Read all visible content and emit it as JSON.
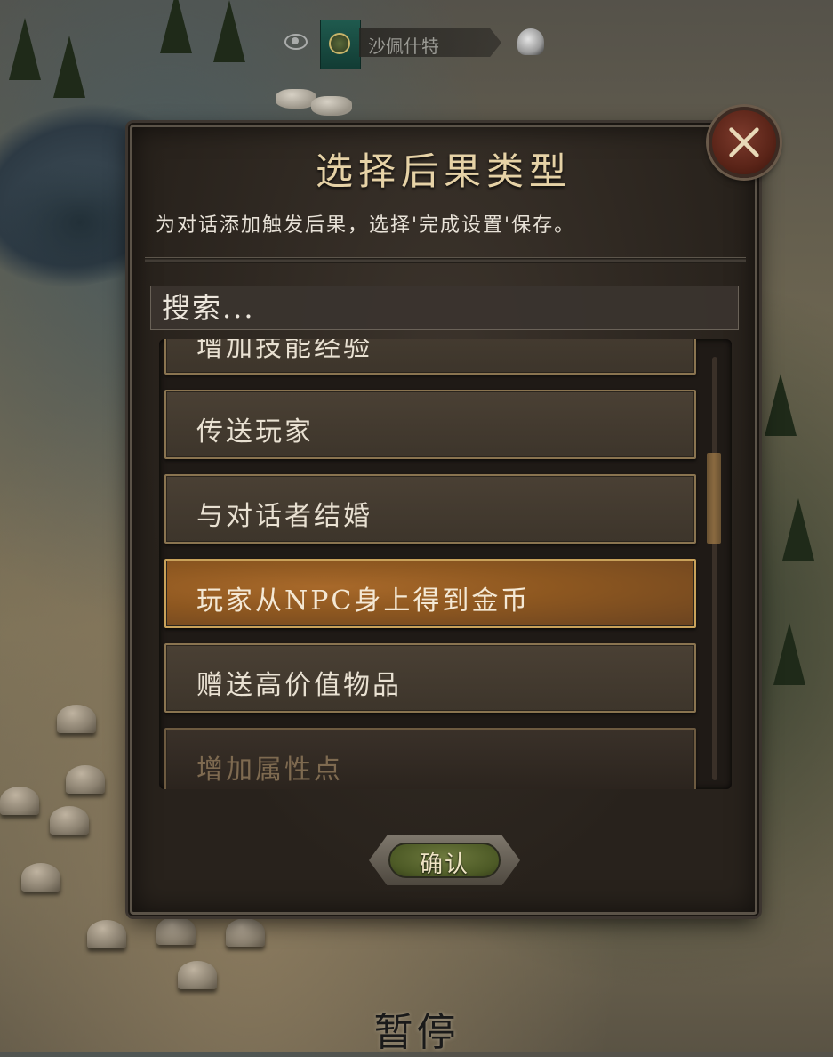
{
  "top_banner": {
    "settlement_name": "沙佩什特"
  },
  "dialog": {
    "title": "选择后果类型",
    "subtitle": "为对话添加触发后果，选择'完成设置'保存。",
    "search": {
      "placeholder": "搜索...",
      "value": ""
    },
    "items": [
      {
        "label": "增加技能经验",
        "state": "partial"
      },
      {
        "label": "传送玩家",
        "state": "normal"
      },
      {
        "label": "与对话者结婚",
        "state": "normal"
      },
      {
        "label": "玩家从NPC身上得到金币",
        "state": "selected"
      },
      {
        "label": "赠送高价值物品",
        "state": "normal"
      },
      {
        "label": "增加属性点",
        "state": "faded"
      }
    ],
    "confirm_label": "确认"
  },
  "footer": {
    "pause_label": "暂停"
  },
  "colors": {
    "accent_gold": "#e6d2a6",
    "selected_orange": "#a8692a",
    "confirm_green": "#4d5a26",
    "close_red": "#5a2418"
  }
}
